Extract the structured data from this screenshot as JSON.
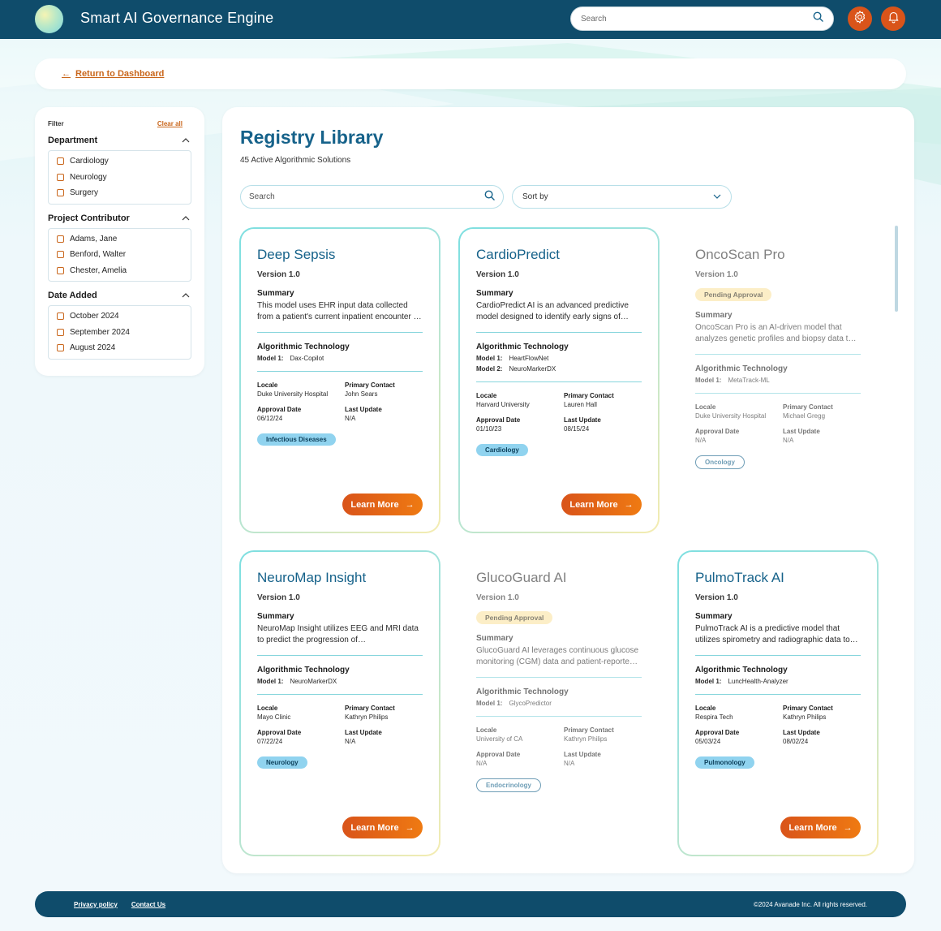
{
  "header": {
    "title": "Smart AI Governance Engine",
    "search_placeholder": "Search",
    "icons": [
      "gear-icon",
      "bell-icon",
      "search-icon"
    ]
  },
  "breadcrumb": {
    "return_label": "Return to Dashboard"
  },
  "filter": {
    "title": "Filter",
    "clear_label": "Clear all",
    "groups": [
      {
        "label": "Department",
        "options": [
          "Cardiology",
          "Neurology",
          "Surgery"
        ]
      },
      {
        "label": "Project Contributor",
        "options": [
          "Adams, Jane",
          "Benford, Walter",
          "Chester, Amelia"
        ]
      },
      {
        "label": "Date Added",
        "options": [
          "October 2024",
          "September 2024",
          "August 2024"
        ]
      }
    ]
  },
  "main": {
    "title": "Registry Library",
    "subtitle": "45 Active Algorithmic Solutions",
    "search_placeholder": "Search",
    "sort_label": "Sort by"
  },
  "labels": {
    "summary": "Summary",
    "tech": "Algorithmic Technology",
    "locale": "Locale",
    "contact": "Primary Contact",
    "approval": "Approval Date",
    "update": "Last Update",
    "learn_more": "Learn More",
    "model1": "Model 1:",
    "model2": "Model 2:"
  },
  "colors": {
    "brand_navy": "#0f4c6b",
    "accent_orange": "#d9541a",
    "title_blue": "#16628a",
    "tag_blue": "#90d3ef",
    "pending_yellow": "#fbe5a6"
  },
  "cards": [
    {
      "title": "Deep Sepsis",
      "version": "Version 1.0",
      "status": "active",
      "summary": "This model uses EHR input data collected from a patient's current inpatient encounter to predict sepsis risk.",
      "models": [
        "Dax-Copilot"
      ],
      "locale": "Duke University Hospital",
      "contact": "John Sears",
      "approval": "06/12/24",
      "update": "N/A",
      "tag": "Infectious Diseases"
    },
    {
      "title": "CardioPredict",
      "version": "Version 1.0",
      "status": "active",
      "summary": "CardioPredict AI is an advanced predictive model designed to identify early signs of cardiovascular disease.",
      "models": [
        "HeartFlowNet",
        "NeuroMarkerDX"
      ],
      "locale": "Harvard University",
      "contact": "Lauren Hall",
      "approval": "01/10/23",
      "update": "08/15/24",
      "tag": "Cardiology"
    },
    {
      "title": "OncoScan Pro",
      "version": "Version 1.0",
      "status": "pending",
      "pending_label": "Pending Approval",
      "summary": "OncoScan Pro is an AI-driven model that analyzes genetic profiles and biopsy data to detect cancer.",
      "models": [
        "MetaTrack-ML"
      ],
      "locale": "Duke University Hospital",
      "contact": "Michael Gregg",
      "approval": "N/A",
      "update": "N/A",
      "tag": "Oncology"
    },
    {
      "title": "NeuroMap Insight",
      "version": "Version 1.0",
      "status": "active",
      "summary": "NeuroMap Insight utilizes EEG and MRI data to predict the progression of neurodegenerative diseases.",
      "models": [
        "NeuroMarkerDX"
      ],
      "locale": "Mayo Clinic",
      "contact": "Kathryn Philips",
      "approval": "07/22/24",
      "update": "N/A",
      "tag": "Neurology"
    },
    {
      "title": "GlucoGuard AI",
      "version": "Version 1.0",
      "status": "pending",
      "pending_label": "Pending Approval",
      "summary": "GlucoGuard AI leverages continuous glucose monitoring (CGM) data and patient-reported outcomes.",
      "models": [
        "GlycoPredictor"
      ],
      "locale": "University of CA",
      "contact": "Kathryn Philips",
      "approval": "N/A",
      "update": "N/A",
      "tag": "Endocrinology"
    },
    {
      "title": "PulmoTrack AI",
      "version": "Version 1.0",
      "status": "active",
      "summary": "PulmoTrack AI is a predictive model that utilizes spirometry and radiographic data to track lung health.",
      "models": [
        "LuncHealth-Analyzer"
      ],
      "locale": "Respira Tech",
      "contact": "Kathryn Philips",
      "approval": "05/03/24",
      "update": "08/02/24",
      "tag": "Pulmonology"
    }
  ],
  "footer": {
    "privacy": "Privacy policy",
    "contact": "Contact Us",
    "copyright": "©2024 Avanade Inc. All rights reserved."
  }
}
